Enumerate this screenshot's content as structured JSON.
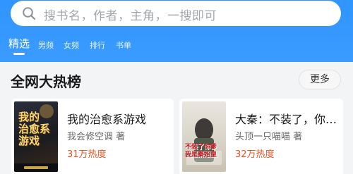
{
  "search": {
    "placeholder": "搜书名，作者，主角，一搜即可"
  },
  "tabs": [
    {
      "label": "精选",
      "active": true
    },
    {
      "label": "男频"
    },
    {
      "label": "女频"
    },
    {
      "label": "排行"
    },
    {
      "label": "书单"
    }
  ],
  "section": {
    "title": "全网大热榜",
    "more_label": "更多"
  },
  "books": [
    {
      "title": "我的治愈系游戏",
      "author": "我会修空调 著",
      "heat": "31万热度",
      "cover_text": "我的治愈系游戏"
    },
    {
      "title": "大秦：不装了，你…",
      "author": "头顶一只喵喵 著",
      "heat": "32万热度",
      "cover_text": "不装了你爹我是秦始皇"
    }
  ],
  "colors": {
    "brand_blue": "#3b9bff",
    "heat_orange": "#f0521f"
  }
}
